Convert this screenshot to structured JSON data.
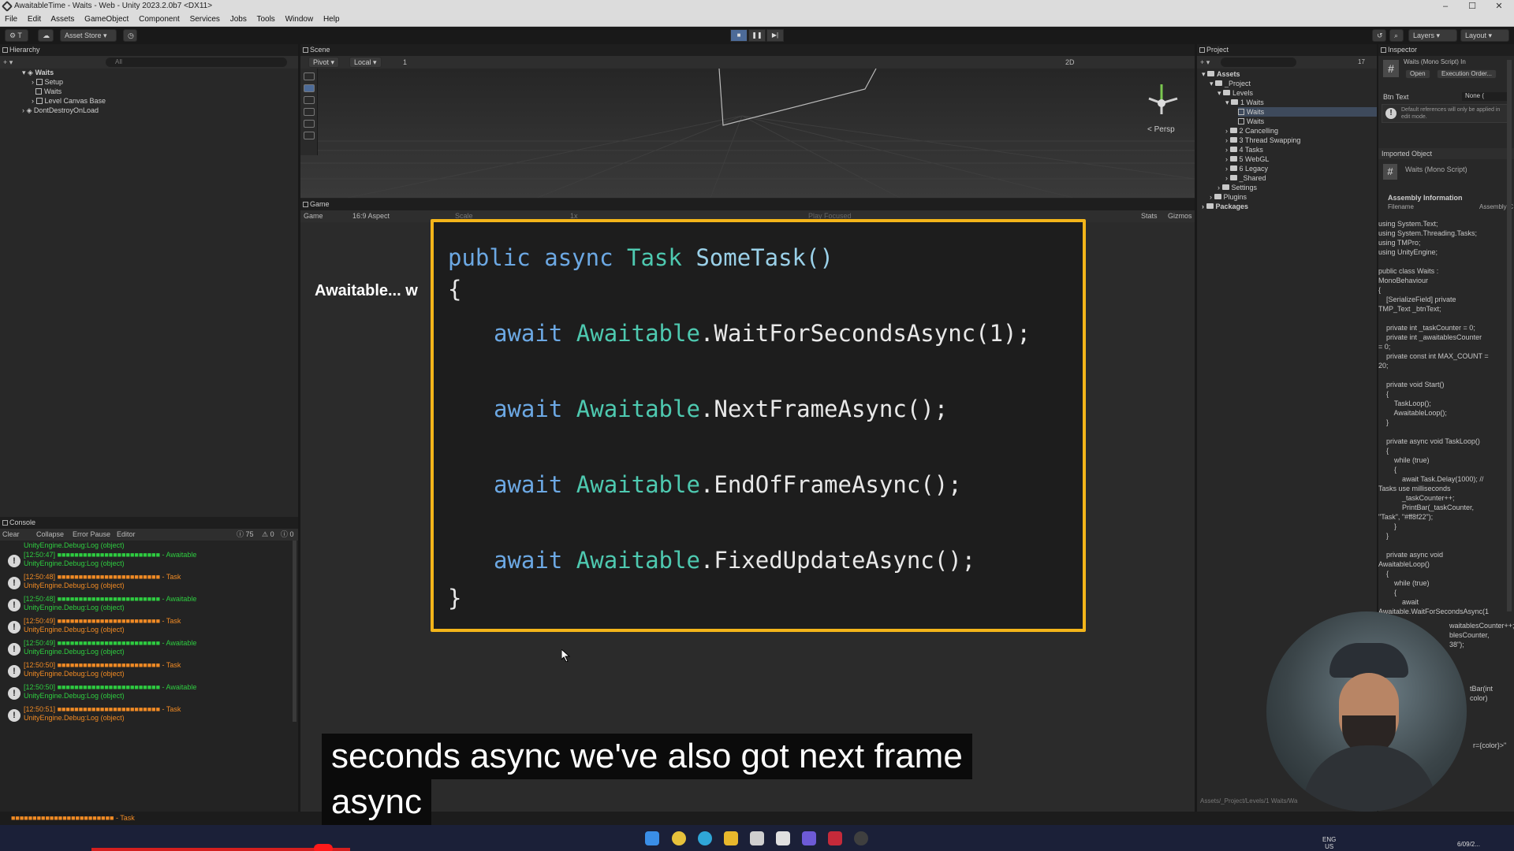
{
  "window": {
    "title": "AwaitableTime - Waits - Web - Unity 2023.2.0b7 <DX11>",
    "minimize": "–",
    "maximize": "☐",
    "close": "✕"
  },
  "menu": [
    "File",
    "Edit",
    "Assets",
    "GameObject",
    "Component",
    "Services",
    "Jobs",
    "Tools",
    "Window",
    "Help"
  ],
  "toolbar": {
    "account": "T",
    "asset_store": "Asset Store",
    "layers": "Layers",
    "layout": "Layout"
  },
  "hierarchy": {
    "tab": "Hierarchy",
    "search_placeholder": "All",
    "scene": "Waits",
    "items": [
      "Setup",
      "Waits",
      "Level Canvas Base"
    ],
    "dontdestroy": "DontDestroyOnLoad"
  },
  "scene": {
    "tab": "Scene",
    "pivot": "Pivot",
    "local": "Local",
    "grid_value": "1",
    "mode_2d": "2D",
    "persp": "< Persp"
  },
  "game": {
    "tab": "Game",
    "display": "Game",
    "aspect": "16:9 Aspect",
    "scale": "Scale",
    "scale_value": "1x",
    "play_focused": "Play Focused",
    "stats": "Stats",
    "gizmos": "Gizmos",
    "overlay_title": "Awaitable... w"
  },
  "code": {
    "l1": {
      "kw1": "public",
      "kw2": "async",
      "type": "Task",
      "name": "SomeTask()"
    },
    "open": "{",
    "close": "}",
    "await": "await",
    "cls": "Awaitable",
    "calls": [
      ".WaitForSecondsAsync(1);",
      ".NextFrameAsync();",
      ".EndOfFrameAsync();",
      ".FixedUpdateAsync();"
    ]
  },
  "console": {
    "tab": "Console",
    "clear": "Clear",
    "collapse": "Collapse",
    "error_pause": "Error Pause",
    "editor": "Editor",
    "count_info": "75",
    "count_warn": "0",
    "count_err": "0",
    "first_line": "UnityEngine.Debug:Log (object)",
    "bar": "■■■■■■■■■■■■■■■■■■■■■■■■",
    "rows": [
      {
        "time": "[12:50:47]",
        "tag": " - Awaitable",
        "color": "green",
        "sub": "UnityEngine.Debug:Log (object)"
      },
      {
        "time": "[12:50:48]",
        "tag": " - Task",
        "color": "orange",
        "sub": "UnityEngine.Debug:Log (object)"
      },
      {
        "time": "[12:50:48]",
        "tag": " - Awaitable",
        "color": "green",
        "sub": "UnityEngine.Debug:Log (object)"
      },
      {
        "time": "[12:50:49]",
        "tag": " - Task",
        "color": "orange",
        "sub": "UnityEngine.Debug:Log (object)"
      },
      {
        "time": "[12:50:49]",
        "tag": " - Awaitable",
        "color": "green",
        "sub": "UnityEngine.Debug:Log (object)"
      },
      {
        "time": "[12:50:50]",
        "tag": " - Task",
        "color": "orange",
        "sub": "UnityEngine.Debug:Log (object)"
      },
      {
        "time": "[12:50:50]",
        "tag": " - Awaitable",
        "color": "green",
        "sub": "UnityEngine.Debug:Log (object)"
      },
      {
        "time": "[12:50:51]",
        "tag": " - Task",
        "color": "orange",
        "sub": "UnityEngine.Debug:Log (object)"
      }
    ],
    "status_bar": "■■■■■■■■■■■■■■■■■■■■■■■■ - Task"
  },
  "project": {
    "tab": "Project",
    "assets": "Assets",
    "project_folder": "_Project",
    "levels": "Levels",
    "level1": "1 Waits",
    "level1_items": [
      "Waits",
      "Waits"
    ],
    "levels_other": [
      "2 Cancelling",
      "3 Thread Swapping",
      "4 Tasks",
      "5 WebGL",
      "6 Legacy",
      "_Shared"
    ],
    "settings": "Settings",
    "plugins": "Plugins",
    "packages": "Packages",
    "count": "17",
    "path": "Assets/_Project/Levels/1 Waits/Wa"
  },
  "inspector": {
    "tab": "Inspector",
    "script_title": "Waits (Mono Script) In",
    "open": "Open",
    "exec_order": "Execution Order...",
    "btn_text": "Btn Text",
    "none": "None (",
    "default_refs": "Default references will only be applied in edit mode.",
    "imported": "Imported Object",
    "imported_name": "Waits (Mono Script)",
    "assembly_info": "Assembly Information",
    "filename": "Filename",
    "assembly": "Assembly-C",
    "code_lines": [
      "using System.Text;",
      "using System.Threading.Tasks;",
      "using TMPro;",
      "using UnityEngine;",
      "",
      "public class Waits :",
      "MonoBehaviour",
      "{",
      "    [SerializeField] private",
      "TMP_Text _btnText;",
      "",
      "    private int _taskCounter = 0;",
      "    private int _awaitablesCounter",
      "= 0;",
      "    private const int MAX_COUNT =",
      "20;",
      "",
      "    private void Start()",
      "    {",
      "        TaskLoop();",
      "        AwaitableLoop();",
      "    }",
      "",
      "    private async void TaskLoop()",
      "    {",
      "        while (true)",
      "        {",
      "            await Task.Delay(1000); //",
      "Tasks use milliseconds",
      "            _taskCounter++;",
      "            PrintBar(_taskCounter,",
      "\"Task\", \"#ff8f22\");",
      "        }",
      "    }",
      "",
      "    private async void",
      "AwaitableLoop()",
      "    {",
      "        while (true)",
      "        {",
      "            await",
      "Awaitable.WaitForSecondsAsync(1"
    ],
    "hidden_lines": [
      "waitablesCounter++;",
      "blesCounter,",
      "38\");",
      "tBar(int",
      "color)",
      "r={color}>\""
    ]
  },
  "caption": {
    "line1": "seconds async we've also got next frame",
    "line2": "async"
  },
  "taskbar": {
    "lang": "ENG",
    "region": "US",
    "date": "6/09/2..."
  }
}
